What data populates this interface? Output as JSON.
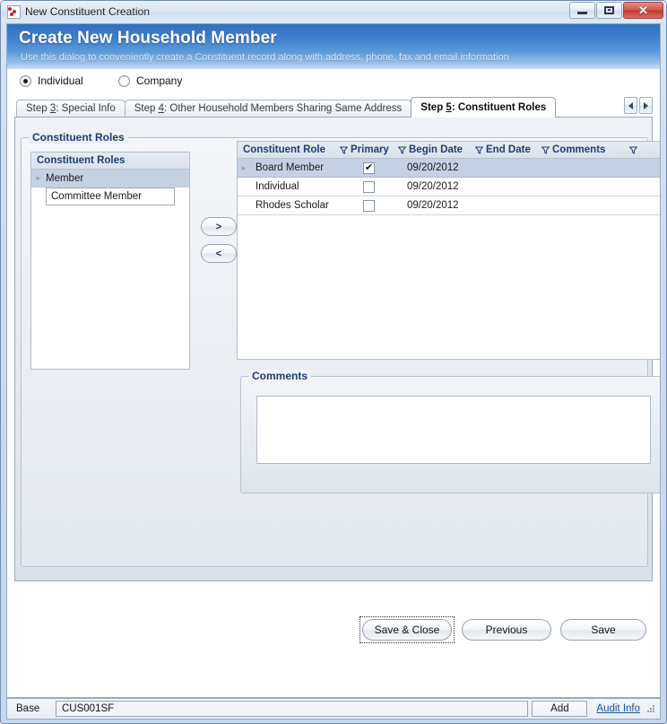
{
  "window": {
    "title": "New Constituent Creation",
    "icon": "app-icon",
    "controls": {
      "minimize": "minimize-button",
      "maximize": "restore-button",
      "close": "close-button"
    }
  },
  "banner": {
    "heading": "Create New Household Member",
    "subtitle": "Use this dialog to conveniently create a Constituent record along with address, phone, fax and email information",
    "accent_color": "#3f7fcd"
  },
  "entity_type": {
    "options": [
      {
        "label": "Individual",
        "selected": true
      },
      {
        "label": "Company",
        "selected": false
      }
    ]
  },
  "tabs": {
    "items": [
      {
        "prefix": "Step ",
        "accel": "3",
        "suffix": ": Special Info",
        "active": false
      },
      {
        "prefix": "Step ",
        "accel": "4",
        "suffix": ": Other Household Members Sharing Same Address",
        "active": false
      },
      {
        "prefix": "Step ",
        "accel": "5",
        "suffix": ": Constituent Roles",
        "active": true
      }
    ],
    "scroll_left": "◀",
    "scroll_right": "▶"
  },
  "groupbox": {
    "title": "Constituent Roles"
  },
  "available_list": {
    "header": "Constituent Roles",
    "rows": [
      {
        "label": "Member",
        "selected": true
      },
      {
        "label": "Committee Member",
        "selected": false
      }
    ]
  },
  "transfer": {
    "add_label": ">",
    "remove_label": "<"
  },
  "grid": {
    "columns": [
      {
        "label": "Constituent Role",
        "filter": true
      },
      {
        "label": "Primary",
        "filter": true
      },
      {
        "label": "Begin Date",
        "filter": true
      },
      {
        "label": "End Date",
        "filter": true
      },
      {
        "label": "Comments",
        "filter": true
      }
    ],
    "rows": [
      {
        "role": "Board Member",
        "primary": true,
        "begin_date": "09/20/2012",
        "end_date": "",
        "comments": "",
        "selected": true
      },
      {
        "role": "Individual",
        "primary": false,
        "begin_date": "09/20/2012",
        "end_date": "",
        "comments": "",
        "selected": false
      },
      {
        "role": "Rhodes Scholar",
        "primary": false,
        "begin_date": "09/20/2012",
        "end_date": "",
        "comments": "",
        "selected": false
      }
    ],
    "checked_glyph": "✔"
  },
  "comments": {
    "title": "Comments",
    "value": "",
    "placeholder": ""
  },
  "footer": {
    "save_close_label": "Save & Close",
    "previous_label": "Previous",
    "save_label": "Save"
  },
  "statusbar": {
    "label": "Base",
    "value": "CUS001SF",
    "add_label": "Add",
    "audit_link": "Audit Info"
  }
}
